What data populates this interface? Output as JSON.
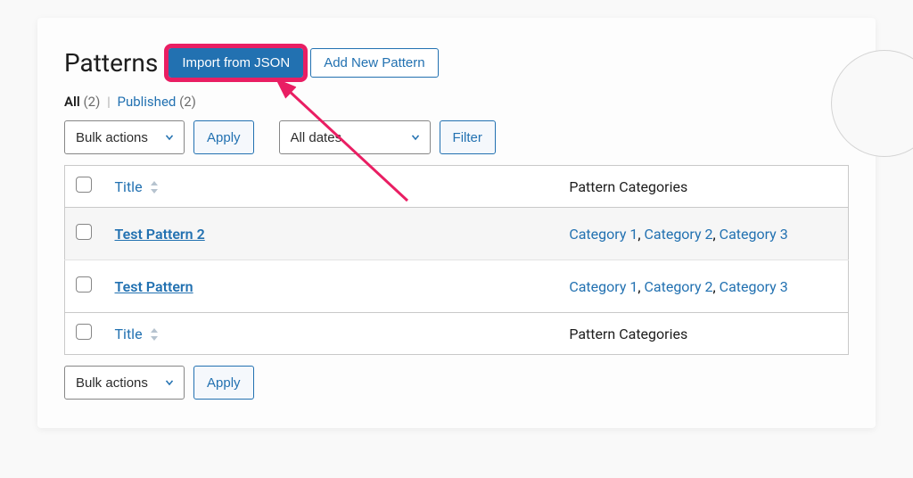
{
  "page": {
    "title": "Patterns"
  },
  "header_buttons": {
    "import_json": "Import from JSON",
    "add_new": "Add New Pattern"
  },
  "views": {
    "all_label": "All",
    "all_count": "(2)",
    "published_label": "Published",
    "published_count": "(2)"
  },
  "bulk": {
    "label": "Bulk actions",
    "apply": "Apply"
  },
  "dates": {
    "label": "All dates",
    "filter": "Filter"
  },
  "columns": {
    "title": "Title",
    "categories": "Pattern Categories"
  },
  "rows": [
    {
      "title": "Test Pattern 2",
      "categories": [
        "Category 1",
        "Category 2",
        "Category 3"
      ]
    },
    {
      "title": "Test Pattern",
      "categories": [
        "Category 1",
        "Category 2",
        "Category 3"
      ]
    }
  ]
}
